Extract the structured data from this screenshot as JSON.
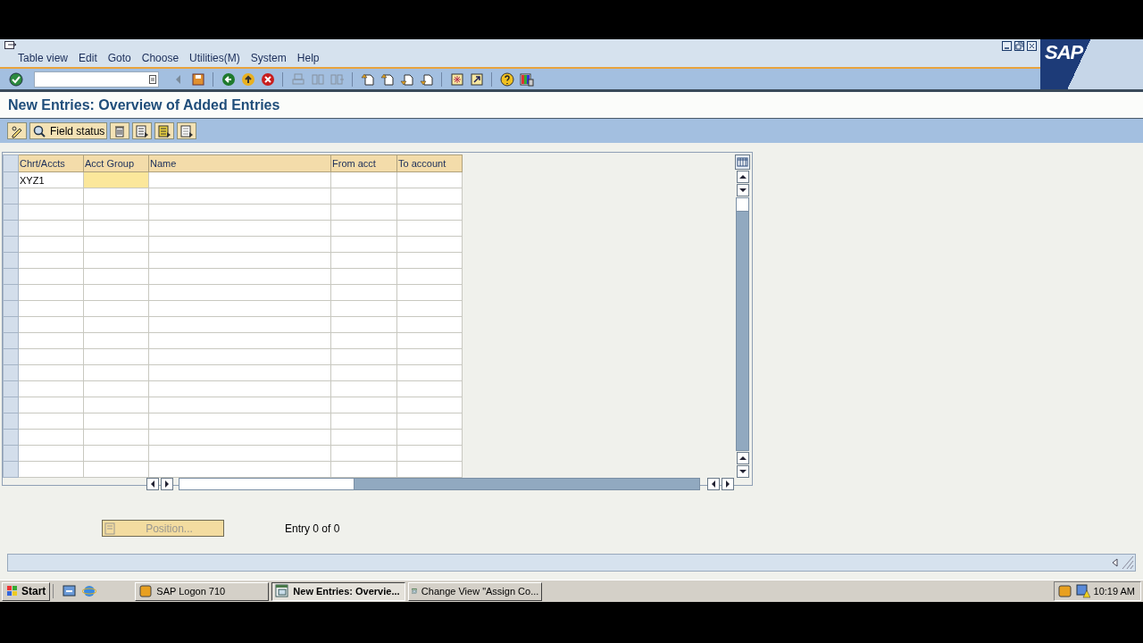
{
  "logo": "SAP",
  "menu": [
    "Table view",
    "Edit",
    "Goto",
    "Choose",
    "Utilities(M)",
    "System",
    "Help"
  ],
  "standard_toolbar": [
    {
      "kind": "enter",
      "disabled": false
    },
    {
      "kind": "command-field"
    },
    {
      "kind": "history",
      "disabled": false
    },
    {
      "kind": "save",
      "disabled": false
    },
    {
      "kind": "sep"
    },
    {
      "kind": "back",
      "disabled": false
    },
    {
      "kind": "exit",
      "disabled": false
    },
    {
      "kind": "cancel",
      "disabled": false
    },
    {
      "kind": "sep"
    },
    {
      "kind": "print",
      "disabled": true
    },
    {
      "kind": "find",
      "disabled": true
    },
    {
      "kind": "find-next",
      "disabled": true
    },
    {
      "kind": "sep"
    },
    {
      "kind": "first-page",
      "disabled": false
    },
    {
      "kind": "previous-page",
      "disabled": false
    },
    {
      "kind": "next-page",
      "disabled": false
    },
    {
      "kind": "last-page",
      "disabled": false
    },
    {
      "kind": "sep"
    },
    {
      "kind": "new-session",
      "disabled": false
    },
    {
      "kind": "shortcut",
      "disabled": false
    },
    {
      "kind": "sep"
    },
    {
      "kind": "help",
      "disabled": false
    },
    {
      "kind": "layout",
      "disabled": false
    }
  ],
  "title": "New Entries: Overview of Added Entries",
  "app_toolbar": [
    {
      "kind": "change"
    },
    {
      "kind": "field-status",
      "label": "Field status"
    },
    {
      "kind": "delete"
    },
    {
      "kind": "select-all"
    },
    {
      "kind": "select-block"
    },
    {
      "kind": "deselect"
    }
  ],
  "table": {
    "columns": [
      "Chrt/Accts",
      "Acct Group",
      "Name",
      "From acct",
      "To account"
    ],
    "rows": [
      {
        "cells": [
          {
            "text": "XYZ1",
            "selected": false
          },
          {
            "selected": true
          },
          {
            "selected": false
          },
          {
            "selected": false
          },
          {
            "selected": false
          }
        ]
      }
    ]
  },
  "position_button": {
    "label": "Position...",
    "disabled": true
  },
  "entry_count": "Entry 0 of 0",
  "taskbar": {
    "start": "Start",
    "tasks": [
      {
        "label": "SAP Logon 710",
        "selected": false,
        "kind": "logon"
      },
      {
        "label": "New Entries: Overvie...",
        "selected": true,
        "kind": "window"
      },
      {
        "label": "Change View \"Assign Co...",
        "selected": false,
        "kind": "window"
      }
    ],
    "clock": "10:19 AM"
  }
}
